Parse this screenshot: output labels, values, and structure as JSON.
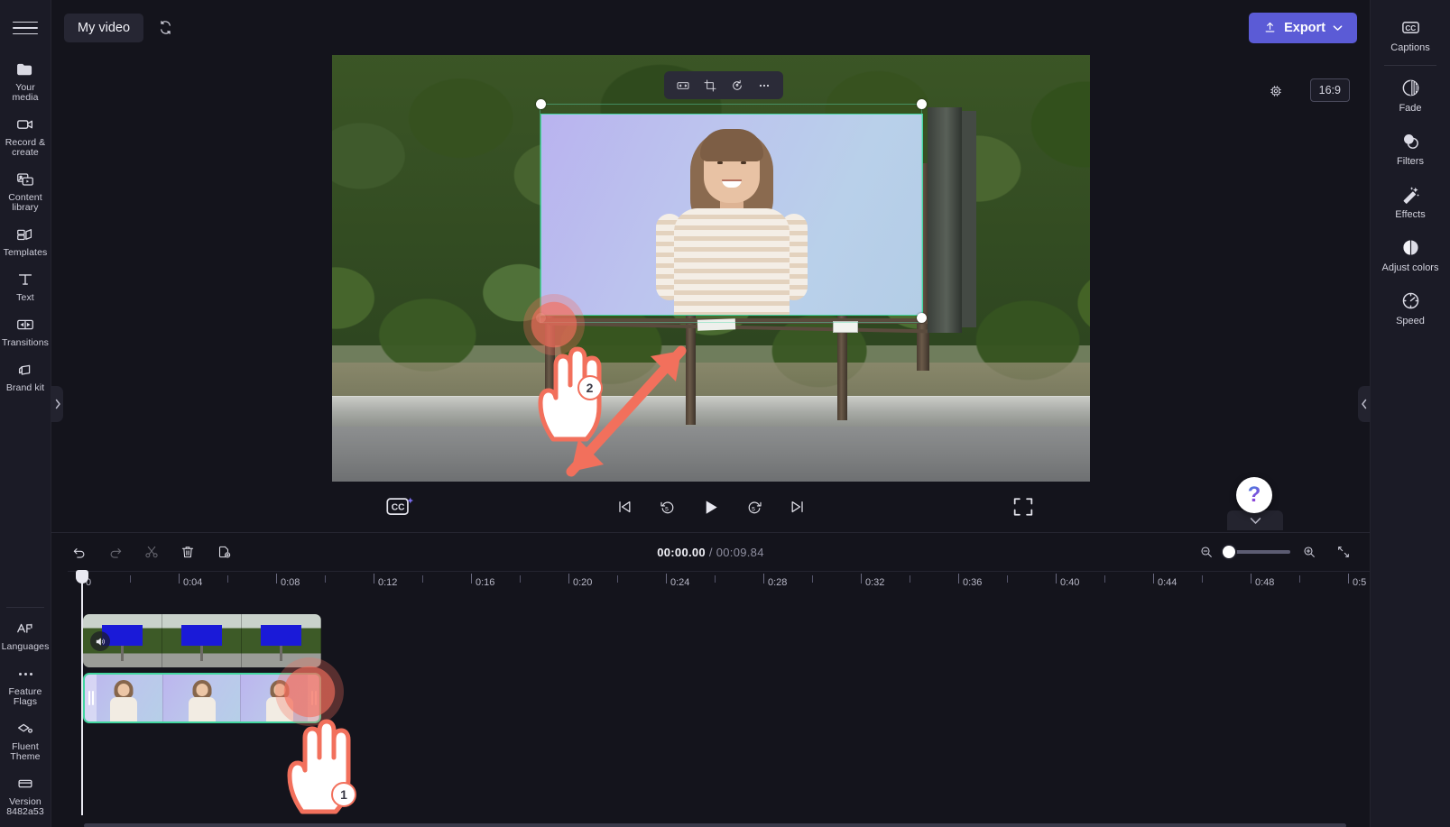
{
  "app": {
    "title": "My video",
    "export_label": "Export"
  },
  "left_rail": {
    "menu_icon": "hamburger-icon",
    "items": [
      {
        "icon": "folder-icon",
        "label": "Your media"
      },
      {
        "icon": "camera-icon",
        "label": "Record & create"
      },
      {
        "icon": "library-icon",
        "label": "Content library"
      },
      {
        "icon": "templates-icon",
        "label": "Templates"
      },
      {
        "icon": "text-icon",
        "label": "Text"
      },
      {
        "icon": "transitions-icon",
        "label": "Transitions"
      },
      {
        "icon": "brandkit-icon",
        "label": "Brand kit"
      }
    ],
    "bottom_items": [
      {
        "icon": "languages-icon",
        "label": "Languages"
      },
      {
        "icon": "more-dots-icon",
        "label": "Feature Flags"
      },
      {
        "icon": "fluent-theme-icon",
        "label": "Fluent Theme"
      },
      {
        "icon": "version-icon",
        "label": "Version 8482a53"
      }
    ]
  },
  "preview": {
    "aspect_ratio": "16:9",
    "settings_icon": "chip-settings-icon",
    "float_toolbar": [
      {
        "icon": "fit-width-icon",
        "name": "fit-to-width"
      },
      {
        "icon": "crop-icon",
        "name": "crop"
      },
      {
        "icon": "rotate-icon",
        "name": "rotate"
      },
      {
        "icon": "more-icon",
        "name": "more-options"
      }
    ],
    "selection_color": "#43d6a0"
  },
  "player": {
    "cc_label": "CC",
    "controls": [
      {
        "icon": "skip-previous-icon",
        "name": "skip-to-start"
      },
      {
        "icon": "rewind-5-icon",
        "name": "rewind-5s"
      },
      {
        "icon": "play-icon",
        "name": "play"
      },
      {
        "icon": "forward-5-icon",
        "name": "forward-5s"
      },
      {
        "icon": "skip-next-icon",
        "name": "skip-to-end"
      }
    ],
    "fullscreen_icon": "fullscreen-icon"
  },
  "timeline": {
    "tools": [
      {
        "icon": "undo-icon",
        "name": "undo",
        "enabled": true
      },
      {
        "icon": "redo-icon",
        "name": "redo",
        "enabled": false
      },
      {
        "icon": "split-icon",
        "name": "split",
        "enabled": false
      },
      {
        "icon": "delete-icon",
        "name": "delete",
        "enabled": true
      },
      {
        "icon": "duplicate-icon",
        "name": "duplicate",
        "enabled": true
      }
    ],
    "current_time": "00:00.00",
    "separator": "/",
    "total_time": "00:09.84",
    "zoom_out_icon": "zoom-out-icon",
    "zoom_in_icon": "zoom-in-icon",
    "zoom_value": 0,
    "fit_icon": "fit-timeline-icon",
    "ruler_labels": [
      "0",
      "0:04",
      "0:08",
      "0:12",
      "0:16",
      "0:20",
      "0:24",
      "0:28",
      "0:32",
      "0:36",
      "0:40",
      "0:44",
      "0:48",
      "0:5"
    ],
    "tracks": [
      {
        "name": "video-track",
        "clip_name": "billboard-clip",
        "muted": false
      },
      {
        "name": "overlay-track",
        "clip_name": "person-clip",
        "selected": true
      }
    ]
  },
  "right_rail": {
    "items": [
      {
        "icon": "captions-icon",
        "label": "Captions"
      },
      {
        "icon": "fade-icon",
        "label": "Fade"
      },
      {
        "icon": "filters-icon",
        "label": "Filters"
      },
      {
        "icon": "effects-icon",
        "label": "Effects"
      },
      {
        "icon": "adjust-colors-icon",
        "label": "Adjust colors"
      },
      {
        "icon": "speed-icon",
        "label": "Speed"
      }
    ]
  },
  "annotations": {
    "step1_number": "1",
    "step2_number": "2",
    "help_glyph": "?"
  },
  "colors": {
    "accent": "#5b5bd6",
    "selection": "#43d6a0",
    "annotation": "#f2705c",
    "panel_bg": "#1b1b26",
    "app_bg": "#14141c"
  }
}
